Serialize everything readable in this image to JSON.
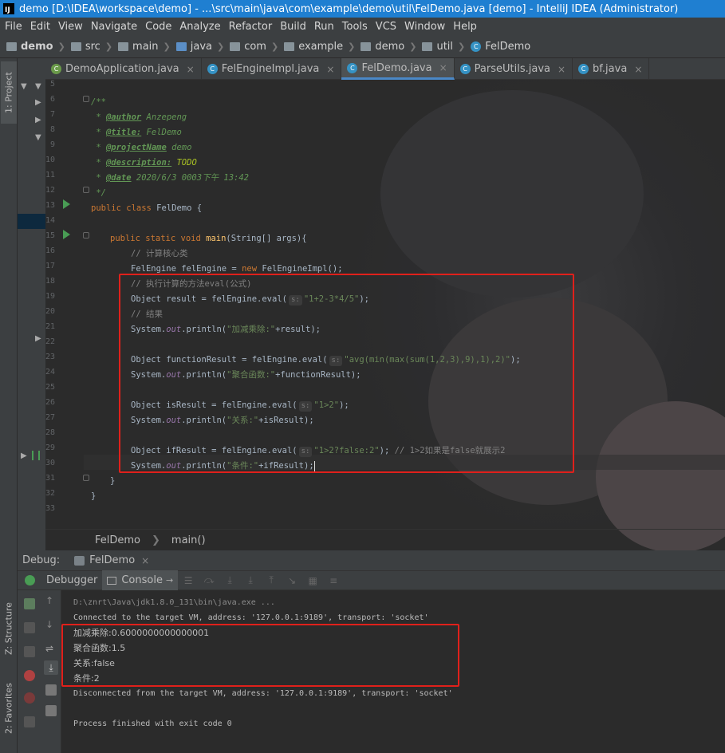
{
  "window": {
    "title": "demo [D:\\IDEA\\workspace\\demo] - ...\\src\\main\\java\\com\\example\\demo\\util\\FelDemo.java [demo] - IntelliJ IDEA (Administrator)",
    "logo_text": "IJ"
  },
  "menu": [
    "File",
    "Edit",
    "View",
    "Navigate",
    "Code",
    "Analyze",
    "Refactor",
    "Build",
    "Run",
    "Tools",
    "VCS",
    "Window",
    "Help"
  ],
  "breadcrumbs": [
    "demo",
    "src",
    "main",
    "java",
    "com",
    "example",
    "demo",
    "util",
    "FelDemo"
  ],
  "left_tabs": {
    "project": "1: Project",
    "structure": "Z: Structure",
    "favorites": "2: Favorites"
  },
  "editor_tabs": [
    {
      "label": "DemoApplication.java",
      "icon": "spring-icon"
    },
    {
      "label": "FelEngineImpl.java",
      "icon": "class-icon"
    },
    {
      "label": "FelDemo.java",
      "icon": "class-icon"
    },
    {
      "label": "ParseUtils.java",
      "icon": "class-icon"
    },
    {
      "label": "bf.java",
      "icon": "class-icon"
    }
  ],
  "line_numbers": [
    "5",
    "6",
    "7",
    "8",
    "9",
    "10",
    "11",
    "12",
    "13",
    "14",
    "15",
    "16",
    "17",
    "18",
    "19",
    "20",
    "21",
    "22",
    "23",
    "24",
    "25",
    "26",
    "27",
    "28",
    "29",
    "30",
    "31",
    "32",
    "33"
  ],
  "code": {
    "l6": "/**",
    "l7_prefix": " * ",
    "l7_tag": "@author",
    "l7_val": " Anzepeng",
    "l8_tag": "@title:",
    "l8_val": " FelDemo",
    "l9_tag": "@projectName",
    "l9_val": " demo",
    "l10_tag": "@description:",
    "l10_val": " TODO",
    "l11_tag": "@date",
    "l11_val": " 2020/6/3 0003下午 13:42",
    "l12": " */",
    "l13_kw": "public class",
    "l13_rest": " FelDemo {",
    "l15_kw": "public static void",
    "l15_mth": "main",
    "l15_rest": "(String[] args){",
    "l16": "// 计算核心类",
    "l17_a": "FelEngine felEngine = ",
    "l17_kw": "new",
    "l17_b": " FelEngineImpl();",
    "l18": "// 执行计算的方法eval(公式)",
    "l19_a": "Object result = felEngine.eval(",
    "l19_hint": "s:",
    "l19_str": "\"1+2-3*4/5\"",
    "l19_b": ");",
    "l20": "// 结果",
    "l21_a": "System.",
    "l21_fld": "out",
    "l21_b": ".println(",
    "l21_str": "\"加减乘除:\"",
    "l21_c": "+result);",
    "l23_a": "Object functionResult = felEngine.eval(",
    "l23_hint": "s:",
    "l23_str": "\"avg(min(max(sum(1,2,3),9),1),2)\"",
    "l23_b": ");",
    "l24_a": "System.",
    "l24_fld": "out",
    "l24_b": ".println(",
    "l24_str": "\"聚合函数:\"",
    "l24_c": "+functionResult);",
    "l26_a": "Object isResult = felEngine.eval(",
    "l26_hint": "s:",
    "l26_str": "\"1>2\"",
    "l26_b": ");",
    "l27_a": "System.",
    "l27_fld": "out",
    "l27_b": ".println(",
    "l27_str": "\"关系:\"",
    "l27_c": "+isResult);",
    "l29_a": "Object ifResult = felEngine.eval(",
    "l29_hint": "s:",
    "l29_str": "\"1>2?false:2\"",
    "l29_b": "); ",
    "l29_cmt": "// 1>2如果是false就展示2",
    "l30_a": "System.",
    "l30_fld": "out",
    "l30_b": ".println(",
    "l30_str": "\"条件:\"",
    "l30_c": "+ifResult);",
    "l31": "}",
    "l32": "}"
  },
  "editor_breadcrumb": [
    "FelDemo",
    "main()"
  ],
  "debug": {
    "label": "Debug:",
    "session": "FelDemo",
    "tab_debugger": "Debugger",
    "tab_console": "Console"
  },
  "console_lines": {
    "path": "D:\\znrt\\Java\\jdk1.8.0_131\\bin\\java.exe ...",
    "connected": "Connected to the target VM, address: '127.0.0.1:9189', transport: 'socket'",
    "out1": "加减乘除:0.6000000000000001",
    "out2": "聚合函数:1.5",
    "out3": "关系:false",
    "out4": "条件:2",
    "disconnected": "Disconnected from the target VM, address: '127.0.0.1:9189', transport: 'socket'",
    "finished": "Process finished with exit code 0"
  },
  "colors": {
    "titlebar": "#1f7fd1",
    "highlight_box": "#e0201b",
    "keyword": "#cc7832",
    "string": "#6a8759",
    "doc": "#629755"
  }
}
